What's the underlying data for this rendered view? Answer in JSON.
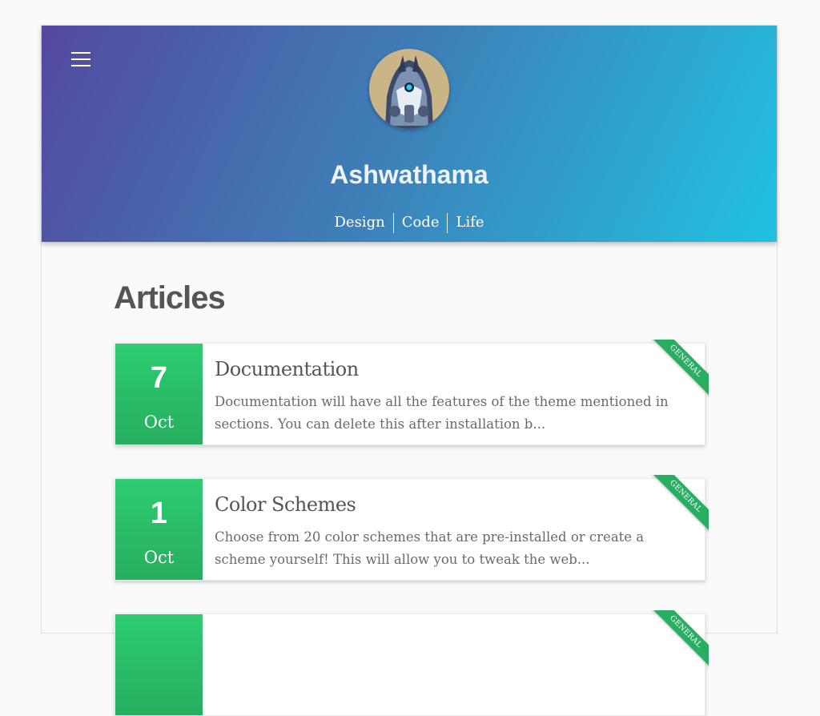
{
  "site": {
    "title": "Ashwathama",
    "nav": [
      "Design",
      "Code",
      "Life"
    ]
  },
  "main": {
    "heading": "Articles",
    "posts": [
      {
        "day": "7",
        "month": "Oct",
        "title": "Documentation",
        "excerpt": "Documentation will have all the features of the theme mentioned in sections. You can delete this after installation b...",
        "tag": "GENERAL"
      },
      {
        "day": "1",
        "month": "Oct",
        "title": "Color Schemes",
        "excerpt": "Choose from 20 color schemes that are pre-installed or create a scheme yourself! This will allow you to tweak the web...",
        "tag": "GENERAL"
      },
      {
        "tag": "GENERAL"
      }
    ]
  },
  "colors": {
    "header_gradient_start": "#54489e",
    "header_gradient_end": "#21c2e0",
    "date_badge": "#2ecc71",
    "ribbon": "#27ae60"
  },
  "icons": {
    "menu": "hamburger-menu-icon",
    "avatar": "robot-helmet-avatar"
  }
}
